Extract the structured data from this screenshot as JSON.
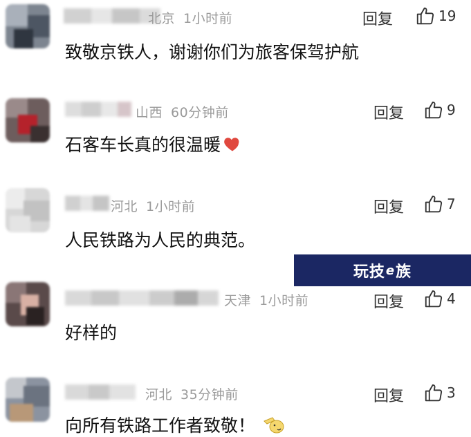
{
  "comments": [
    {
      "location": "北京",
      "time": "1小时前",
      "reply_label": "回复",
      "likes": "19",
      "text": "致敬京铁人，谢谢你们为旅客保驾护航",
      "emoji": ""
    },
    {
      "location": "山西",
      "time": "60分钟前",
      "reply_label": "回复",
      "likes": "9",
      "text": "石客车长真的很温暖",
      "emoji": "heart"
    },
    {
      "location": "河北",
      "time": "1小时前",
      "reply_label": "回复",
      "likes": "7",
      "text": "人民铁路为人民的典范。",
      "emoji": ""
    },
    {
      "location": "天津",
      "time": "1小时前",
      "reply_label": "回复",
      "likes": "4",
      "text": "好样的",
      "emoji": ""
    },
    {
      "location": "河北",
      "time": "35分钟前",
      "reply_label": "回复",
      "likes": "3",
      "text": "向所有铁路工作者致敬！",
      "emoji": "salute"
    }
  ],
  "watermark": {
    "part1": "玩技",
    "part2": "e",
    "part3": "族"
  },
  "colors": {
    "meta": "#9a9a9a",
    "watermark_bg": "#1b2763",
    "heart": "#e0483e"
  }
}
